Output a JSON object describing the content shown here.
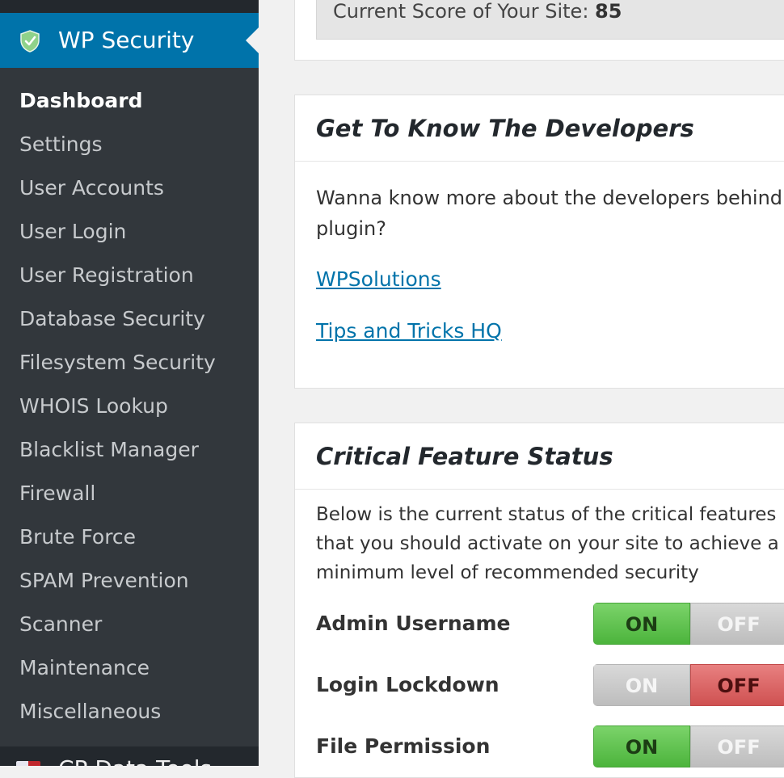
{
  "sidebar": {
    "active_menu": {
      "label": "WP Security",
      "icon": "shield-icon",
      "accent": "#0073aa"
    },
    "items": [
      {
        "label": "Dashboard",
        "current": true
      },
      {
        "label": "Settings"
      },
      {
        "label": "User Accounts"
      },
      {
        "label": "User Login"
      },
      {
        "label": "User Registration"
      },
      {
        "label": "Database Security"
      },
      {
        "label": "Filesystem Security"
      },
      {
        "label": "WHOIS Lookup"
      },
      {
        "label": "Blacklist Manager"
      },
      {
        "label": "Firewall"
      },
      {
        "label": "Brute Force"
      },
      {
        "label": "SPAM Prevention"
      },
      {
        "label": "Scanner"
      },
      {
        "label": "Maintenance"
      },
      {
        "label": "Miscellaneous"
      }
    ],
    "next_menu": {
      "label": "CP Data Tools"
    }
  },
  "score": {
    "label": "Current Score of Your Site:",
    "value": "85"
  },
  "developers": {
    "title": "Get To Know The Developers",
    "line1": "Wanna know more about the developers behind",
    "line2": "plugin?",
    "links": [
      "WPSolutions",
      "Tips and Tricks HQ"
    ]
  },
  "critical": {
    "title": "Critical Feature Status",
    "line1": "Below is the current status of the critical features",
    "line2": "that you should activate on your site to achieve a",
    "line3": "minimum level of recommended security",
    "features": [
      {
        "label": "Admin Username",
        "on": "ON",
        "off": "OFF",
        "state": "on"
      },
      {
        "label": "Login Lockdown",
        "on": "ON",
        "off": "OFF",
        "state": "off"
      },
      {
        "label": "File Permission",
        "on": "ON",
        "off": "OFF",
        "state": "on"
      }
    ]
  }
}
